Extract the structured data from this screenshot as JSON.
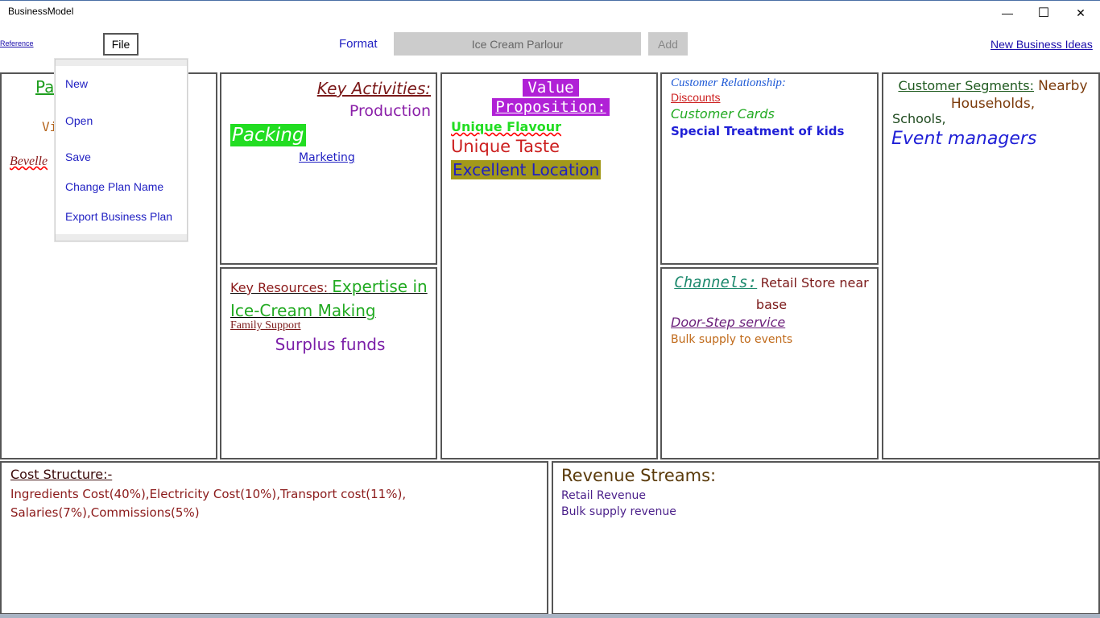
{
  "window": {
    "title": "BusinessModel",
    "minimize_glyph": "—",
    "maximize_glyph": "☐",
    "close_glyph": "✕"
  },
  "toolbar": {
    "reference": "Reference",
    "file": "File",
    "format": "Format",
    "plan_name_value": "Ice Cream Parlour",
    "add": "Add",
    "new_ideas": "New Business Ideas"
  },
  "file_menu": {
    "items": [
      "New",
      "Open",
      "Save",
      "Change Plan Name",
      "Export Business Plan"
    ]
  },
  "key_partners": {
    "heading_partial": "Pa",
    "line2_partial": "Vi",
    "line3_partial": "Bevelle"
  },
  "key_activities": {
    "heading": "Key Activities:",
    "items": [
      "Production",
      "Packing",
      "Marketing"
    ]
  },
  "key_resources": {
    "heading": "Key Resources:",
    "items": [
      "Expertise in Ice-Cream Making",
      "Family Support",
      "Surplus funds"
    ]
  },
  "value_proposition": {
    "heading_line1": "Value",
    "heading_line2": "Proposition:",
    "items": [
      "Unique Flavour",
      "Unique Taste",
      "Excellent Location"
    ]
  },
  "customer_relationship": {
    "heading": "Customer Relationship:",
    "items": [
      "Discounts",
      "Customer Cards",
      "Special Treatment of kids"
    ]
  },
  "channels": {
    "heading": "Channels:",
    "first_item": "Retail Store near base",
    "items": [
      "Door-Step service",
      "Bulk supply to events"
    ]
  },
  "customer_segments": {
    "heading": "Customer Segments:",
    "items": [
      "Nearby Households,",
      "Schools,",
      "Event managers"
    ]
  },
  "cost_structure": {
    "heading": "Cost Structure:-",
    "text": "Ingredients Cost(40%),Electricity Cost(10%),Transport cost(11%), Salaries(7%),Commissions(5%)"
  },
  "revenue_streams": {
    "heading": "Revenue Streams:",
    "items": [
      "Retail Revenue",
      "Bulk supply revenue"
    ]
  }
}
